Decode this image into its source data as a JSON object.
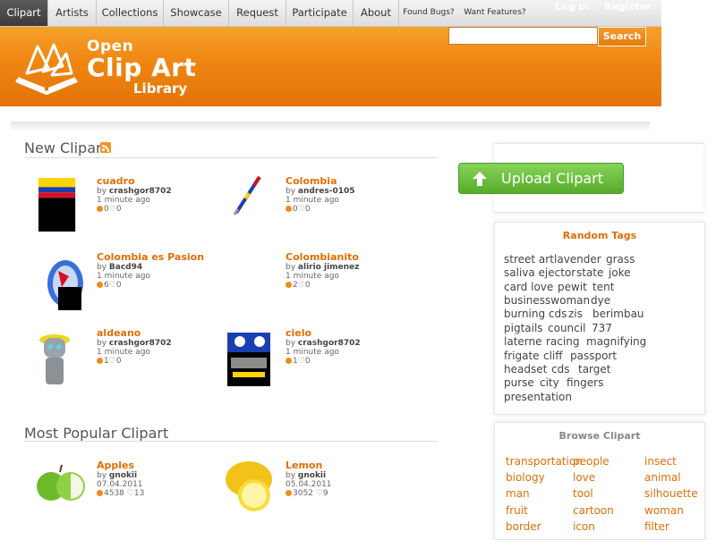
{
  "nav": {
    "items": [
      "Clipart",
      "Artists",
      "Collections",
      "Showcase",
      "Request",
      "Participate",
      "About"
    ],
    "small_items": [
      "Found Bugs?",
      "Want Features?"
    ],
    "login": "Log in",
    "separator": "|",
    "register": "Register"
  },
  "header": {
    "logo_open": "Open",
    "logo_clipart": "Clip Art",
    "logo_library": "Library",
    "search_button": "Search",
    "search_value": ""
  },
  "new_clipart": {
    "title": "New Clipart",
    "items": [
      {
        "title": "cuadro",
        "by": "by ",
        "author": "crashgor8702",
        "time": "1 minute ago",
        "downloads": "0",
        "likes": "0"
      },
      {
        "title": "Colombia",
        "by": "by ",
        "author": "andres-0105",
        "time": "1 minute ago",
        "downloads": "0",
        "likes": "0"
      },
      {
        "title": "Colombia es Pasion",
        "by": "by ",
        "author": "Bacd94",
        "time": "1 minute ago",
        "downloads": "6",
        "likes": "0"
      },
      {
        "title": "Colombianito",
        "by": "by ",
        "author": "alirio jimenez",
        "time": "1 minute ago",
        "downloads": "2",
        "likes": "0"
      },
      {
        "title": "aldeano",
        "by": "by ",
        "author": "crashgor8702",
        "time": "1 minute ago",
        "downloads": "1",
        "likes": "0"
      },
      {
        "title": "cielo",
        "by": "by ",
        "author": "crashgor8702",
        "time": "1 minute ago",
        "downloads": "1",
        "likes": "0"
      }
    ]
  },
  "popular_clipart": {
    "title": "Most Popular Clipart",
    "items": [
      {
        "title": "Apples",
        "by": "by ",
        "author": "gnokii",
        "time": "07.04.2011",
        "downloads": "4538",
        "likes": "13"
      },
      {
        "title": "Lemon",
        "by": "by ",
        "author": "gnokii",
        "time": "05.04.2011",
        "downloads": "3052",
        "likes": "9"
      }
    ]
  },
  "sidebar": {
    "upload_label": "Upload Clipart",
    "random_tags_title": "Random Tags",
    "random_tags": [
      [
        "street art",
        "lavender",
        "grass"
      ],
      [
        "saliva ejector",
        "state",
        "joke"
      ],
      [
        "card love",
        "pewit",
        "tent"
      ],
      [
        "businesswoman",
        "dye"
      ],
      [
        "burning cds",
        "zis",
        "berimbau"
      ],
      [
        "pigtails",
        "council",
        "737"
      ],
      [
        "laterne",
        "racing",
        "magnifying"
      ],
      [
        "frigate",
        "cliff",
        "passport"
      ],
      [
        "headset",
        "cds",
        "target"
      ],
      [
        "purse",
        "city",
        "fingers"
      ],
      [
        "presentation"
      ]
    ],
    "browse_title": "Browse Clipart",
    "browse": [
      [
        "transportation",
        "people",
        "insect"
      ],
      [
        "biology",
        "love",
        "animal"
      ],
      [
        "man",
        "tool",
        "silhouette"
      ],
      [
        "fruit",
        "cartoon",
        "woman"
      ],
      [
        "border",
        "icon",
        "filter"
      ]
    ]
  },
  "colors": {
    "orange_header": "#ef8611",
    "link_orange": "#e06f07",
    "upload_green": "#6cc23e"
  }
}
